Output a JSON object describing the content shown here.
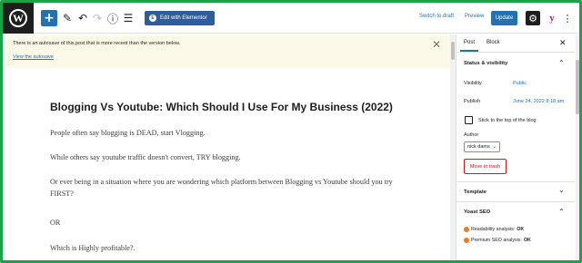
{
  "toolbar": {
    "switch_to_draft": "Switch to draft",
    "preview": "Preview",
    "update": "Update",
    "elementor": "Edit with Elementor",
    "elementor_icon_letter": "E",
    "wp_logo_letter": "W",
    "add_symbol": "+",
    "undo_symbol": "↶",
    "redo_symbol": "↷",
    "info_symbol": "ⓘ",
    "outline_symbol": "☰",
    "pencil_symbol": "✎",
    "settings_symbol": "⚙",
    "yoast_symbol": "y",
    "more_symbol": "⋮"
  },
  "notice": {
    "text": "There is an autosave of this post that is more recent than the version below.",
    "link": "View the autosave",
    "close": "✕"
  },
  "post": {
    "title": "Blogging Vs Youtube: Which Should I Use For My Business (2022)",
    "paragraphs": [
      "People often say blogging is DEAD, start Vlogging.",
      "While others say youtube traffic doesn't convert, TRY blogging.",
      "Or ever being in a situation where you are wondering which platform between Blogging vs Youtube should you try FIRST?",
      "OR",
      "Which is Highly profitable?."
    ]
  },
  "sidebar": {
    "tabs": [
      "Post",
      "Block"
    ],
    "close": "✕",
    "status_visibility": {
      "heading": "Status & visibility",
      "visibility_label": "Visibility",
      "visibility_value": "Public",
      "publish_label": "Publish",
      "publish_value": "June 24, 2022 8:18 am",
      "sticky_label": "Stick to the top of the blog",
      "author_label": "Author",
      "author_value": "nick dams",
      "trash": "Move to trash"
    },
    "template_heading": "Template",
    "yoast": {
      "heading": "Yoast SEO",
      "readability_label": "Readability analysis:",
      "readability_value": "OK",
      "premium_label": "Premium SEO analysis:",
      "premium_value": "OK"
    },
    "chevron_up": "⌃",
    "chevron_down": "⌄"
  },
  "colors": {
    "accent": "#2271b1",
    "frame": "#1aa24a",
    "danger": "#cc1818",
    "yoast_dot": "#ee7c1b"
  }
}
